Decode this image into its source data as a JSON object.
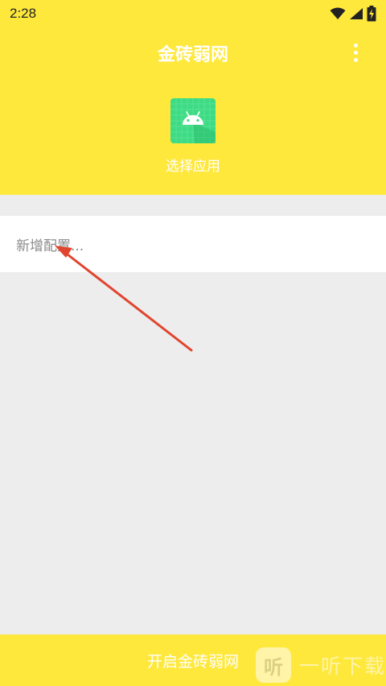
{
  "status_bar": {
    "time": "2:28",
    "icons": [
      "wifi-icon",
      "signal-icon",
      "battery-charging-icon"
    ]
  },
  "header": {
    "title": "金砖弱网",
    "menu_icon": "more-vertical-icon",
    "select_app": {
      "icon": "android-app-icon",
      "label": "选择应用"
    }
  },
  "config": {
    "placeholder": "新增配置..."
  },
  "bottom_bar": {
    "label": "开启金砖弱网"
  },
  "watermark": {
    "logo": "听",
    "text": "一听下载"
  },
  "colors": {
    "accent": "#ffe83c",
    "background": "#ededed",
    "annotation": "#e0452e",
    "android_green": "#3ddc84"
  }
}
